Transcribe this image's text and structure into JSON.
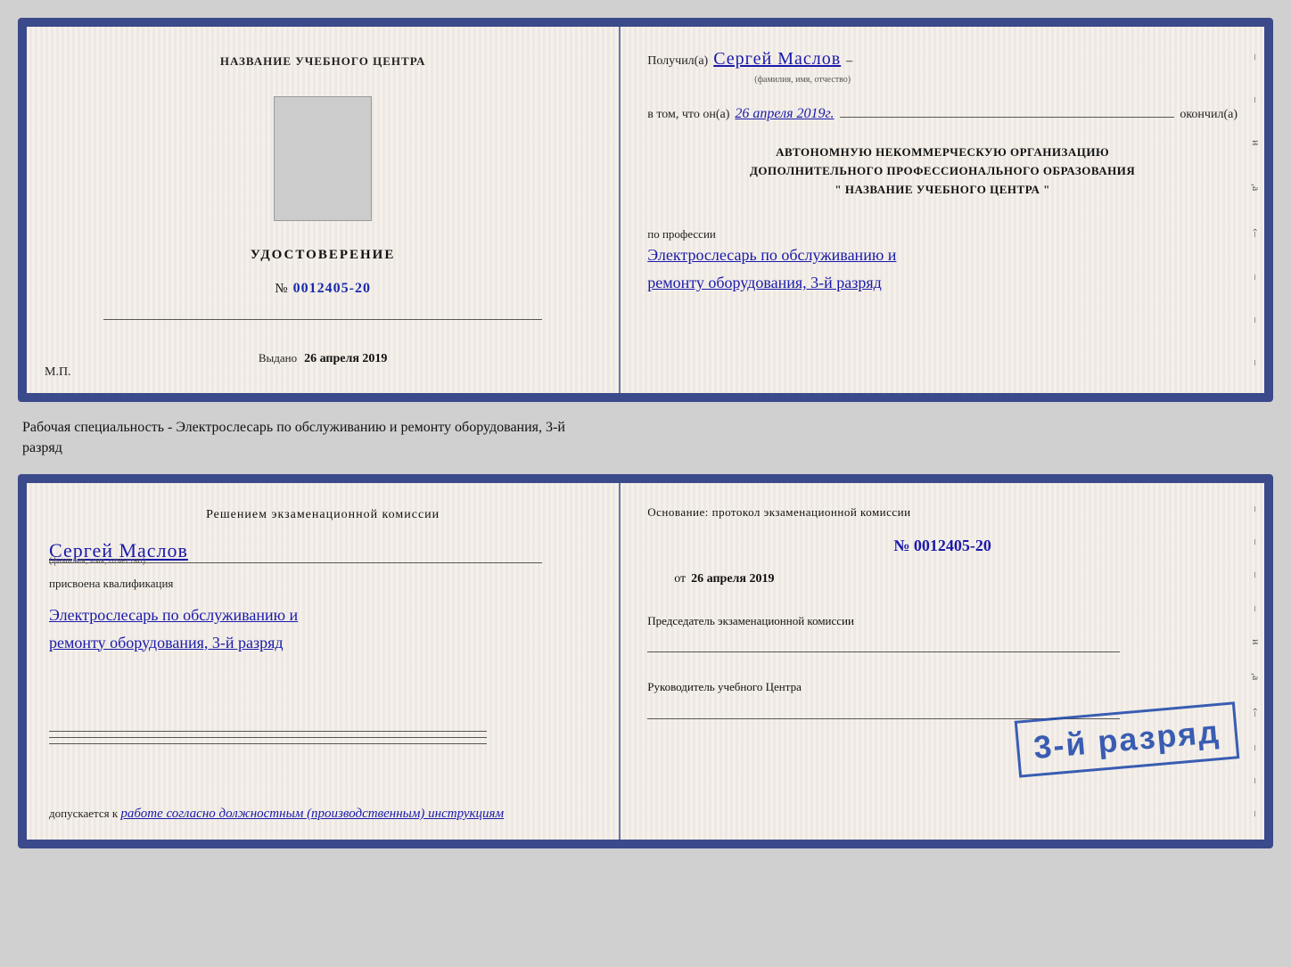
{
  "page": {
    "background": "#d0d0d0"
  },
  "top_cert": {
    "left": {
      "center_name": "НАЗВАНИЕ УЧЕБНОГО ЦЕНТРА",
      "title": "УДОСТОВЕРЕНИЕ",
      "number_label": "№",
      "number_value": "0012405-20",
      "issued_label": "Выдано",
      "issued_date": "26 апреля 2019",
      "mp_label": "М.П."
    },
    "right": {
      "received_label": "Получил(а)",
      "recipient_name": "Сергей Маслов",
      "fio_sublabel": "(фамилия, имя, отчество)",
      "dash": "–",
      "vtom_label": "в том, что он(а)",
      "date_value": "26 апреля 2019г.",
      "okonchill_label": "окончил(а)",
      "org_line1": "АВТОНОМНУЮ НЕКОММЕРЧЕСКУЮ ОРГАНИЗАЦИЮ",
      "org_line2": "ДОПОЛНИТЕЛЬНОГО ПРОФЕССИОНАЛЬНОГО ОБРАЗОВАНИЯ",
      "org_line3": "\"  НАЗВАНИЕ УЧЕБНОГО ЦЕНТРА  \"",
      "po_professii": "по профессии",
      "profession_line1": "Электрослесарь по обслуживанию и",
      "profession_line2": "ремонту оборудования, 3-й разряд"
    }
  },
  "between_text": {
    "line1": "Рабочая специальность - Электрослесарь по обслуживанию и ремонту оборудования, 3-й",
    "line2": "разряд"
  },
  "bottom_cert": {
    "left": {
      "decision_text": "Решением экзаменационной комиссии",
      "person_name": "Сергей Маслов",
      "fio_sublabel": "(фамилия, имя, отчество)",
      "prisvoena_label": "присвоена квалификация",
      "qualification_line1": "Электрослесарь по обслуживанию и",
      "qualification_line2": "ремонту оборудования, 3-й разряд",
      "dopuskaetsya_label": "допускается к",
      "dopusk_text": "работе согласно должностным (производственным) инструкциям"
    },
    "right": {
      "osnovaniye_label": "Основание: протокол экзаменационной комиссии",
      "number_label": "№",
      "number_value": "0012405-20",
      "ot_label": "от",
      "ot_date": "26 апреля 2019",
      "predsedatel_label": "Председатель экзаменационной комиссии",
      "rukovoditel_label": "Руководитель учебного Центра"
    },
    "stamp": {
      "text": "3-й разряд"
    }
  }
}
